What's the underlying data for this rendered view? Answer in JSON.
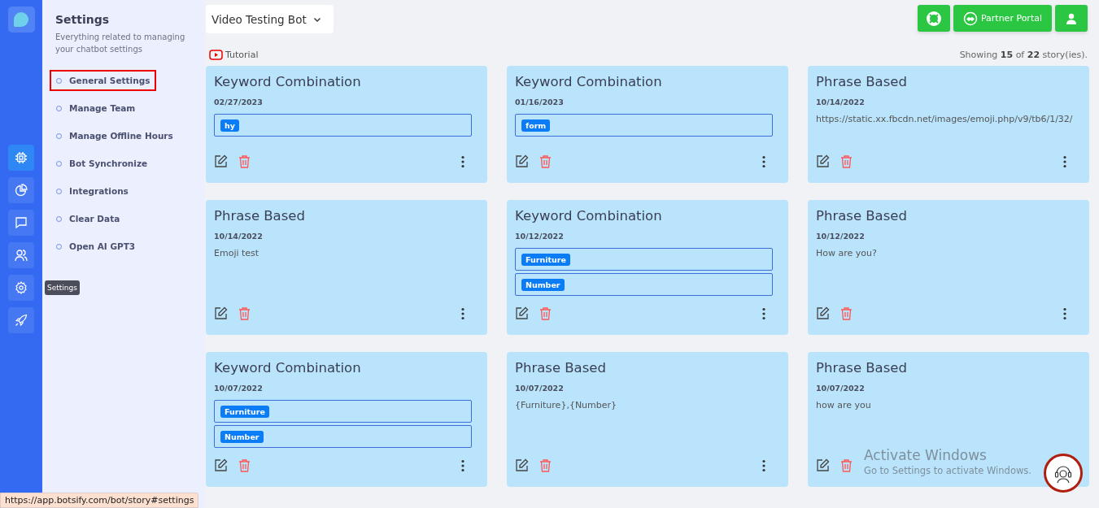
{
  "rail": {
    "items": [
      {
        "selected": true
      },
      {
        "selected": false
      },
      {
        "selected": false
      },
      {
        "selected": false
      },
      {
        "selected": false
      },
      {
        "selected": false
      }
    ],
    "tooltip": "Settings"
  },
  "settings_panel": {
    "title": "Settings",
    "subtitle": "Everything related to managing your chatbot settings",
    "items": [
      {
        "label": "General Settings",
        "selected": true
      },
      {
        "label": "Manage Team",
        "selected": false
      },
      {
        "label": "Manage Offline Hours",
        "selected": false
      },
      {
        "label": "Bot Synchronize",
        "selected": false
      },
      {
        "label": "Integrations",
        "selected": false
      },
      {
        "label": "Clear Data",
        "selected": false
      },
      {
        "label": "Open AI GPT3",
        "selected": false
      }
    ]
  },
  "bot_selector": "Video Testing Bot",
  "header_buttons": {
    "partner_portal": "Partner Portal"
  },
  "tutorial_link": "Tutorial",
  "showing": {
    "prefix": "Showing",
    "shown": "15",
    "middle": "of",
    "total": "22",
    "suffix": "story(ies)."
  },
  "stories": [
    {
      "title": "Keyword Combination",
      "date": "02/27/2023",
      "kind": "keywords",
      "keywords": [
        "hy"
      ]
    },
    {
      "title": "Keyword Combination",
      "date": "01/16/2023",
      "kind": "keywords",
      "keywords": [
        "form"
      ]
    },
    {
      "title": "Phrase Based",
      "date": "10/14/2022",
      "kind": "phrase",
      "phrase": "https://static.xx.fbcdn.net/images/emoji.php/v9/tb6/1/32/"
    },
    {
      "title": "Phrase Based",
      "date": "10/14/2022",
      "kind": "phrase",
      "phrase": "Emoji test"
    },
    {
      "title": "Keyword Combination",
      "date": "10/12/2022",
      "kind": "keywords",
      "keywords": [
        "Furniture",
        "Number"
      ]
    },
    {
      "title": "Phrase Based",
      "date": "10/12/2022",
      "kind": "phrase",
      "phrase": "How are you?"
    },
    {
      "title": "Keyword Combination",
      "date": "10/07/2022",
      "kind": "keywords",
      "keywords": [
        "Furniture",
        "Number"
      ]
    },
    {
      "title": "Phrase Based",
      "date": "10/07/2022",
      "kind": "phrase",
      "phrase": "{Furniture},{Number}"
    },
    {
      "title": "Phrase Based",
      "date": "10/07/2022",
      "kind": "phrase",
      "phrase": "how are you"
    }
  ],
  "os_notice": {
    "title": "Activate Windows",
    "text": "Go to Settings to activate Windows."
  },
  "status_url": "https://app.botsify.com/bot/story#settings"
}
